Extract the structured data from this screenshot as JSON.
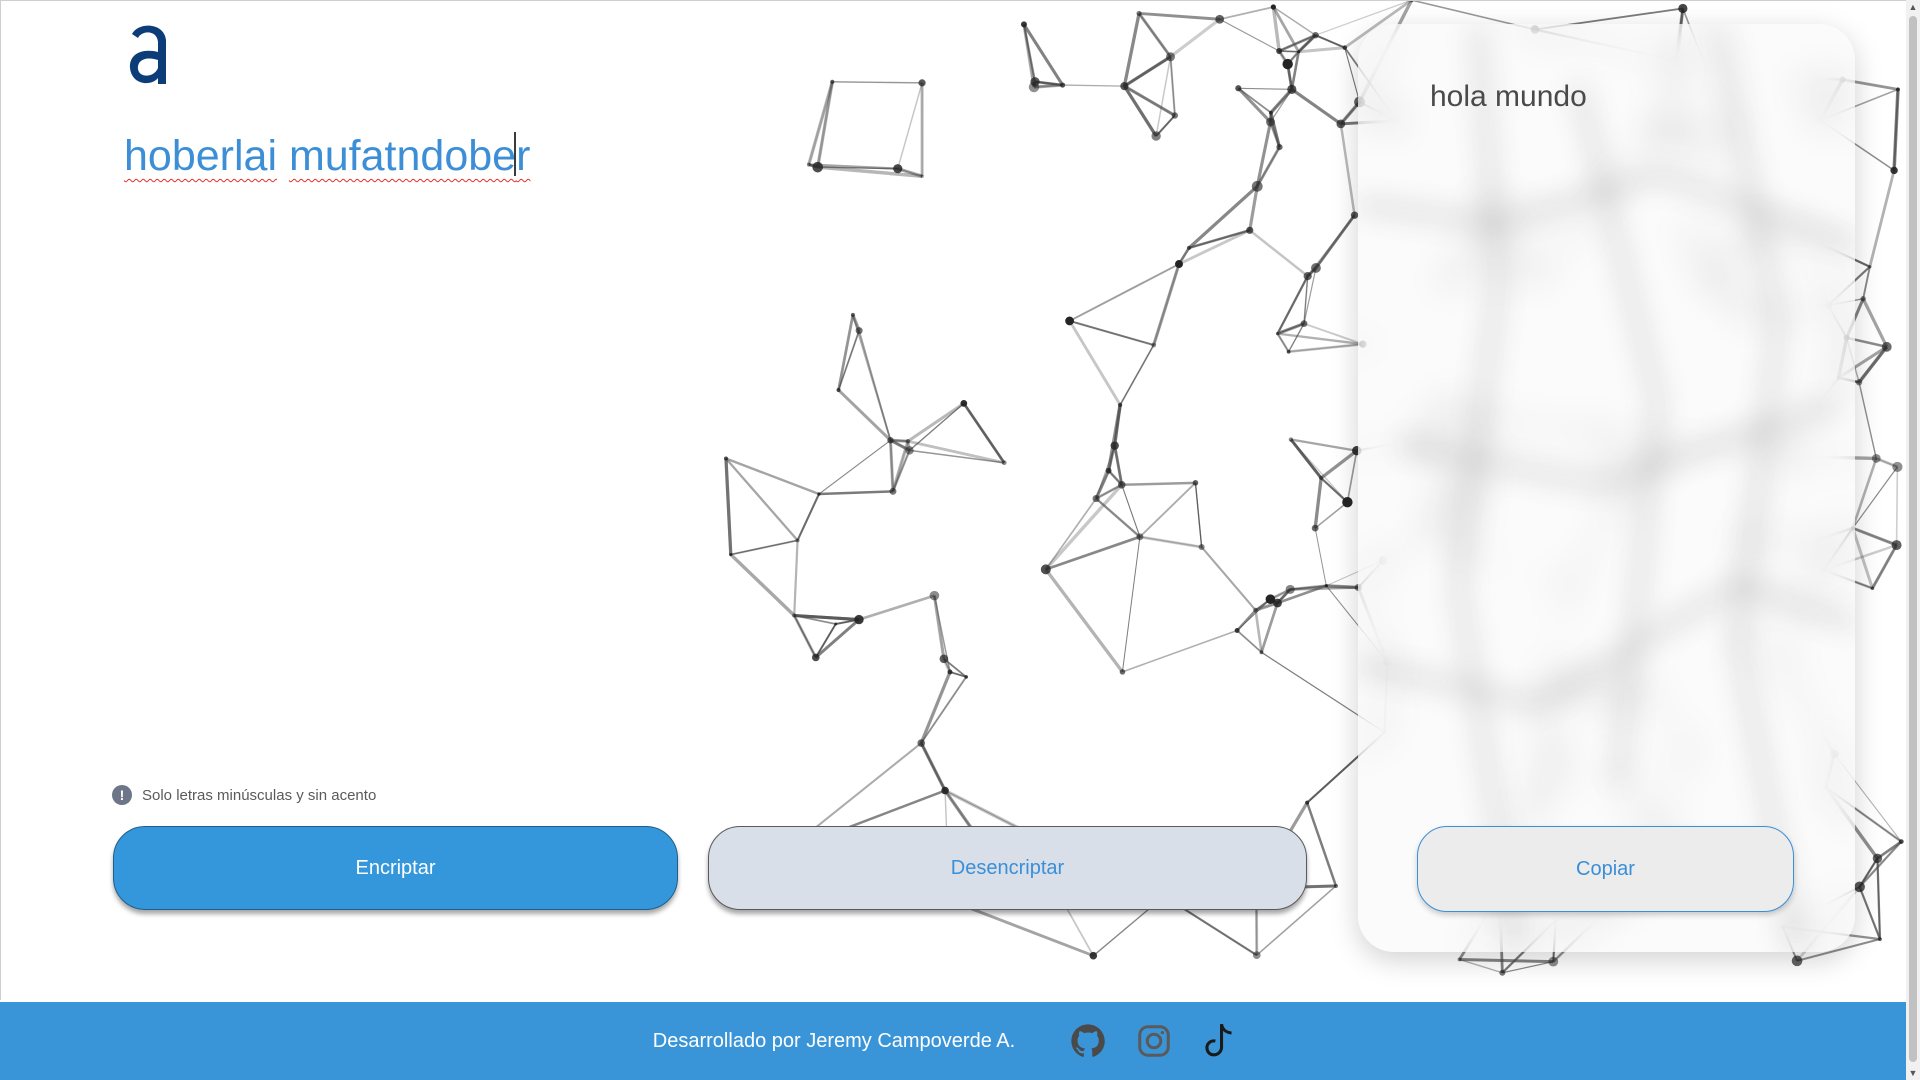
{
  "app": {
    "input_text_word1": "hoberlai",
    "input_text_word2": "mufatndobe",
    "input_text_tail": "r",
    "hint": "Solo letras minúsculas y sin acento",
    "hint_icon": "!"
  },
  "buttons": {
    "encrypt": "Encriptar",
    "decrypt": "Desencriptar",
    "copy": "Copiar"
  },
  "result": {
    "text": "hola mundo"
  },
  "footer": {
    "credit": "Desarrollado por Jeremy Campoverde A.",
    "icons": [
      "github-icon",
      "instagram-icon",
      "tiktok-icon"
    ]
  },
  "colors": {
    "accent": "#3497dc",
    "text_blue": "#3a8fd8",
    "decrypt_bg": "#d9dfe8",
    "footer_bg": "#3a95d8"
  }
}
